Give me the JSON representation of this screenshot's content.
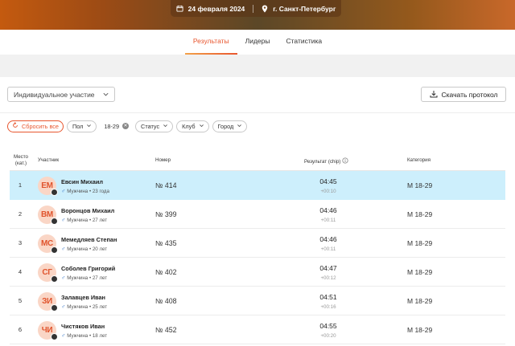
{
  "event": {
    "date": "24 февраля 2024",
    "city": "г. Санкт-Петербург"
  },
  "tabs": [
    {
      "label": "Результаты",
      "active": true
    },
    {
      "label": "Лидеры",
      "active": false
    },
    {
      "label": "Статистика",
      "active": false
    }
  ],
  "toolbar": {
    "participation_select": "Индивидуальное участие",
    "download_label": "Скачать протокол"
  },
  "filters": {
    "reset_label": "Сбросить все",
    "gender_label": "Пол",
    "age_selected": "18-29",
    "status_label": "Статус",
    "club_label": "Клуб",
    "city_label": "Город"
  },
  "table": {
    "headers": {
      "place_line1": "Место",
      "place_line2": "(кат.)",
      "participant": "Участник",
      "number": "Номер",
      "result": "Результат (chip)",
      "category": "Категория"
    },
    "rows": [
      {
        "place": "1",
        "initials": "ЕМ",
        "name": "Евсин Михаил",
        "meta": "Мужчина • 23 года",
        "number": "№ 414",
        "time": "04:45",
        "gap": "+00:10",
        "category": "М 18-29"
      },
      {
        "place": "2",
        "initials": "ВМ",
        "name": "Воронцов Михаил",
        "meta": "Мужчина • 27 лет",
        "number": "№ 399",
        "time": "04:46",
        "gap": "+00:11",
        "category": "М 18-29"
      },
      {
        "place": "3",
        "initials": "МС",
        "name": "Мемедляев Степан",
        "meta": "Мужчина • 20 лет",
        "number": "№ 435",
        "time": "04:46",
        "gap": "+00:11",
        "category": "М 18-29"
      },
      {
        "place": "4",
        "initials": "СГ",
        "name": "Соболев Григорий",
        "meta": "Мужчина • 27 лет",
        "number": "№ 402",
        "time": "04:47",
        "gap": "+00:12",
        "category": "М 18-29"
      },
      {
        "place": "5",
        "initials": "ЗИ",
        "name": "Залавцев Иван",
        "meta": "Мужчина • 25 лет",
        "number": "№ 408",
        "time": "04:51",
        "gap": "+00:16",
        "category": "М 18-29"
      },
      {
        "place": "6",
        "initials": "ЧИ",
        "name": "Чистяков Иван",
        "meta": "Мужчина • 18 лет",
        "number": "№ 452",
        "time": "04:55",
        "gap": "+00:20",
        "category": "М 18-29"
      }
    ]
  },
  "colors": {
    "accent": "#e8562e",
    "highlight_row": "#cdeffc",
    "avatar_bg": "#fad6c6"
  }
}
